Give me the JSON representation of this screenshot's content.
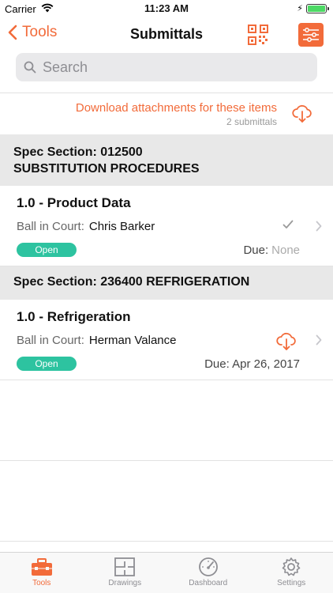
{
  "status_bar": {
    "carrier": "Carrier",
    "time": "11:23 AM"
  },
  "nav": {
    "back_label": "Tools",
    "title": "Submittals"
  },
  "search": {
    "placeholder": "Search"
  },
  "download": {
    "title": "Download attachments for these items",
    "subtitle": "2 submittals"
  },
  "sections": [
    {
      "header_line1": "Spec Section: 012500",
      "header_line2": "SUBSTITUTION PROCEDURES",
      "item": {
        "name": "1.0 - Product Data",
        "ball_in_court_label": "Ball in Court:",
        "ball_in_court_person": "Chris Barker",
        "status": "Open",
        "due_label": "Due:",
        "due_value": "None"
      }
    },
    {
      "header_line1": "Spec Section: 236400 REFRIGERATION",
      "item": {
        "name": "1.0 - Refrigeration",
        "ball_in_court_label": "Ball in Court:",
        "ball_in_court_person": "Herman Valance",
        "status": "Open",
        "due_label": "Due:",
        "due_value": "Apr 26, 2017"
      }
    }
  ],
  "tabbar": {
    "tabs": [
      {
        "label": "Tools",
        "icon": "toolbox-icon",
        "active": true
      },
      {
        "label": "Drawings",
        "icon": "floorplan-icon",
        "active": false
      },
      {
        "label": "Dashboard",
        "icon": "gauge-icon",
        "active": false
      },
      {
        "label": "Settings",
        "icon": "gear-icon",
        "active": false
      }
    ]
  },
  "colors": {
    "accent": "#f26b3a",
    "status_open": "#2dc3a0",
    "section_bg": "#e8e8e8"
  }
}
